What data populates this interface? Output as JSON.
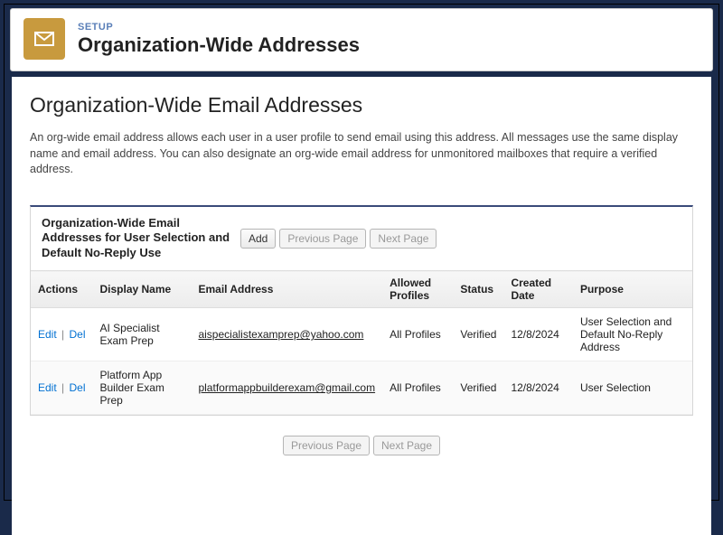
{
  "header": {
    "eyebrow": "SETUP",
    "title": "Organization-Wide Addresses"
  },
  "page": {
    "title": "Organization-Wide Email Addresses",
    "help": "An org-wide email address allows each user in a user profile to send email using this address. All messages use the same display name and email address. You can also designate an org-wide email address for unmonitored mailboxes that require a verified address."
  },
  "listBlock": {
    "title": "Organization-Wide Email Addresses for User Selection and Default No-Reply Use",
    "buttons": {
      "add": "Add",
      "prev": "Previous Page",
      "next": "Next Page"
    }
  },
  "table": {
    "columns": {
      "actions": "Actions",
      "displayName": "Display Name",
      "email": "Email Address",
      "allowed": "Allowed Profiles",
      "status": "Status",
      "created": "Created Date",
      "purpose": "Purpose"
    },
    "actionLabels": {
      "edit": "Edit",
      "del": "Del"
    },
    "rows": [
      {
        "displayName": "AI Specialist Exam Prep",
        "email": "aispecialistexamprep@yahoo.com",
        "allowed": "All Profiles",
        "status": "Verified",
        "created": "12/8/2024",
        "purpose": "User Selection and Default No-Reply Address"
      },
      {
        "displayName": "Platform App Builder Exam Prep",
        "email": "platformappbuilderexam@gmail.com",
        "allowed": "All Profiles",
        "status": "Verified",
        "created": "12/8/2024",
        "purpose": "User Selection"
      }
    ]
  },
  "pagerBottom": {
    "prev": "Previous Page",
    "next": "Next Page"
  }
}
